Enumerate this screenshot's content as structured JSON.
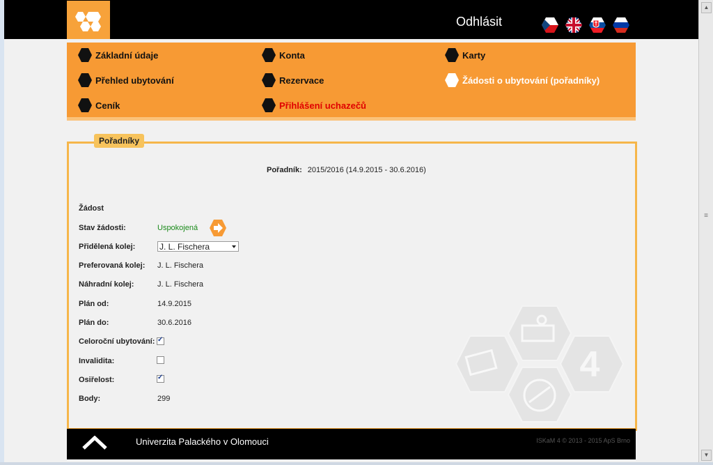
{
  "header": {
    "logout_label": "Odhlásit",
    "flags": [
      "czech-flag-icon",
      "uk-flag-icon",
      "slovak-flag-icon",
      "russian-flag-icon"
    ]
  },
  "menu": {
    "items": [
      {
        "label": "Základní údaje"
      },
      {
        "label": "Konta"
      },
      {
        "label": "Karty"
      },
      {
        "label": "Přehled ubytování"
      },
      {
        "label": "Rezervace"
      },
      {
        "label": "Žádosti o ubytování (pořadníky)"
      },
      {
        "label": "Ceník"
      },
      {
        "label": "Přihlášení uchazečů"
      }
    ],
    "accent": "#f79a34",
    "active_index": 5,
    "highlight_red": "#e00000"
  },
  "panel": {
    "tab_label": "Pořadníky",
    "poradnik_label": "Pořadník:",
    "poradnik_value": "2015/2016 (14.9.2015 - 30.6.2016)",
    "section_title": "Žádost",
    "rows": {
      "stav_label": "Stav žádosti:",
      "stav_value": "Uspokojená",
      "pridelena_label": "Přidělená kolej:",
      "pridelena_value": "J. L. Fischera",
      "preferovana_label": "Preferovaná kolej:",
      "preferovana_value": "J. L. Fischera",
      "nahradni_label": "Náhradní kolej:",
      "nahradni_value": "J. L. Fischera",
      "plan_od_label": "Plán od:",
      "plan_od_value": "14.9.2015",
      "plan_do_label": "Plán do:",
      "plan_do_value": "30.6.2016",
      "celorocni_label": "Celoroční ubytování:",
      "celorocni_checked": true,
      "invalidita_label": "Invalidita:",
      "invalidita_checked": false,
      "osirelost_label": "Osiřelost:",
      "osirelost_checked": true,
      "body_label": "Body:",
      "body_value": "299"
    },
    "watermark_number": "4"
  },
  "footer": {
    "university": "Univerzita Palackého v Olomouci",
    "copyright": "ISKaM 4 © 2013 - 2015 ApS Brno"
  }
}
